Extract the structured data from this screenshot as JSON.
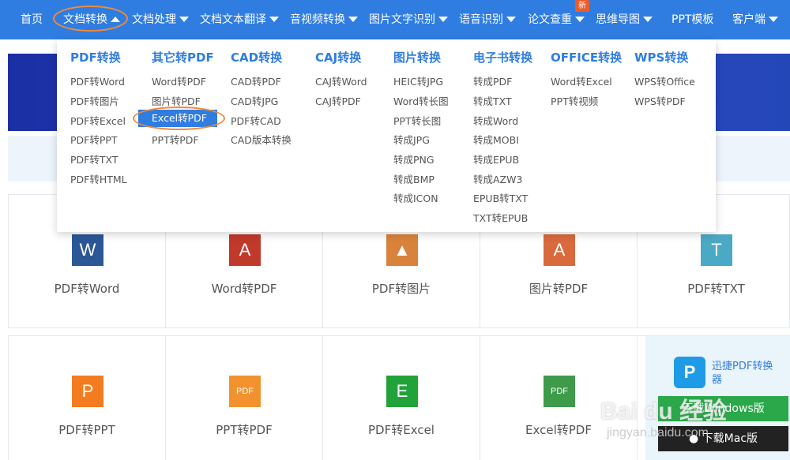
{
  "nav": {
    "items": [
      {
        "label": "首页",
        "dropdown": false
      },
      {
        "label": "文档转换",
        "dropdown": true,
        "active": true
      },
      {
        "label": "文档处理",
        "dropdown": true
      },
      {
        "label": "文档文本翻译",
        "dropdown": true
      },
      {
        "label": "音视频转换",
        "dropdown": true
      },
      {
        "label": "图片文字识别",
        "dropdown": true
      },
      {
        "label": "语音识别",
        "dropdown": true
      },
      {
        "label": "论文查重",
        "dropdown": true
      },
      {
        "label": "思维导图",
        "dropdown": true
      },
      {
        "label": "PPT模板",
        "dropdown": false
      },
      {
        "label": "客户端",
        "dropdown": true
      }
    ],
    "badge": "新"
  },
  "dropdown": {
    "columns": [
      {
        "heading": "PDF转换",
        "links": [
          "PDF转Word",
          "PDF转图片",
          "PDF转Excel",
          "PDF转PPT",
          "PDF转TXT",
          "PDF转HTML"
        ]
      },
      {
        "heading": "其它转PDF",
        "links": [
          "Word转PDF",
          "图片转PDF",
          "Excel转PDF",
          "PPT转PDF"
        ]
      },
      {
        "heading": "CAD转换",
        "links": [
          "CAD转PDF",
          "CAD转JPG",
          "PDF转CAD",
          "CAD版本转换"
        ]
      },
      {
        "heading": "CAJ转换",
        "links": [
          "CAJ转Word",
          "CAJ转PDF"
        ]
      },
      {
        "heading": "图片转换",
        "links": [
          "HEIC转JPG",
          "Word转长图",
          "PPT转长图",
          "转成JPG",
          "转成PNG",
          "转成BMP",
          "转成ICON"
        ]
      },
      {
        "heading": "电子书转换",
        "links": [
          "转成PDF",
          "转成TXT",
          "转成Word",
          "转成MOBI",
          "转成EPUB",
          "转成AZW3",
          "EPUB转TXT",
          "TXT转EPUB"
        ]
      },
      {
        "heading": "OFFICE转换",
        "links": [
          "Word转Excel",
          "PPT转视频"
        ]
      },
      {
        "heading": "WPS转换",
        "links": [
          "WPS转Office",
          "WPS转PDF"
        ]
      }
    ],
    "selected": "Excel转PDF"
  },
  "tiles_row1": [
    {
      "label": "PDF转Word",
      "icon_letter": "W",
      "color": "#2b5797"
    },
    {
      "label": "Word转PDF",
      "icon_letter": "A",
      "color": "#c0392b"
    },
    {
      "label": "PDF转图片",
      "icon_letter": "▲",
      "color": "#d9823b"
    },
    {
      "label": "图片转PDF",
      "icon_letter": "A",
      "color": "#d86a3e"
    },
    {
      "label": "PDF转TXT",
      "icon_letter": "T",
      "color": "#4aa9c4"
    }
  ],
  "tiles_row2": [
    {
      "label": "PDF转PPT",
      "icon_letter": "P",
      "color": "#f47c20"
    },
    {
      "label": "PPT转PDF",
      "icon_letter": "PDF",
      "color": "#f2922e"
    },
    {
      "label": "PDF转Excel",
      "icon_letter": "E",
      "color": "#21a33a"
    },
    {
      "label": "Excel转PDF",
      "icon_letter": "PDF",
      "color": "#3d9b4a"
    }
  ],
  "promo": {
    "title": "迅捷PDF转换器",
    "win_button": "下载Windows版",
    "mac_button": "下载Mac版"
  },
  "watermark": {
    "text": "Bai du 经验",
    "url": "jingyan.baidu.com"
  }
}
